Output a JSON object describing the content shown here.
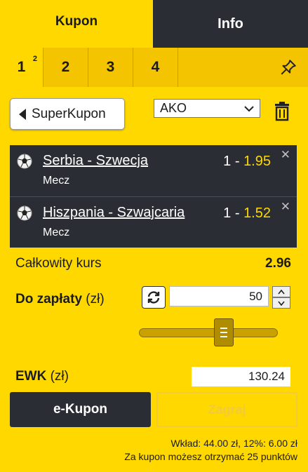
{
  "tabs": {
    "kupon": "Kupon",
    "info": "Info"
  },
  "coupon_tabs": [
    {
      "label": "1",
      "badge": "2"
    },
    {
      "label": "2"
    },
    {
      "label": "3"
    },
    {
      "label": "4"
    }
  ],
  "superkupon_label": "SuperKupon",
  "bet_type_select": "AKO",
  "bets": [
    {
      "name": "Serbia - Szwecja",
      "type": "Mecz",
      "pick": "1 - ",
      "odds": "1.95"
    },
    {
      "name": "Hiszpania - Szwajcaria",
      "type": "Mecz",
      "pick": "1 - ",
      "odds": "1.52"
    }
  ],
  "total": {
    "label": "Całkowity kurs",
    "value": "2.96"
  },
  "pay": {
    "label": "Do zapłaty",
    "unit": " (zł)",
    "stake": "50"
  },
  "stake_slider_level": 0.6,
  "ewk": {
    "label": "EWK",
    "unit": " (zł)",
    "value": "130.24"
  },
  "buttons": {
    "ekupon": "e-Kupon",
    "zagraj": "Zagraj"
  },
  "footer": {
    "line1": "Wkład: 44.00 zł, 12%: 6.00 zł",
    "line2": "Za kupon możesz otrzymać 25 punktów"
  },
  "colors": {
    "accent": "#ffd800",
    "dark": "#2a2d34",
    "odds": "#ffd800"
  }
}
